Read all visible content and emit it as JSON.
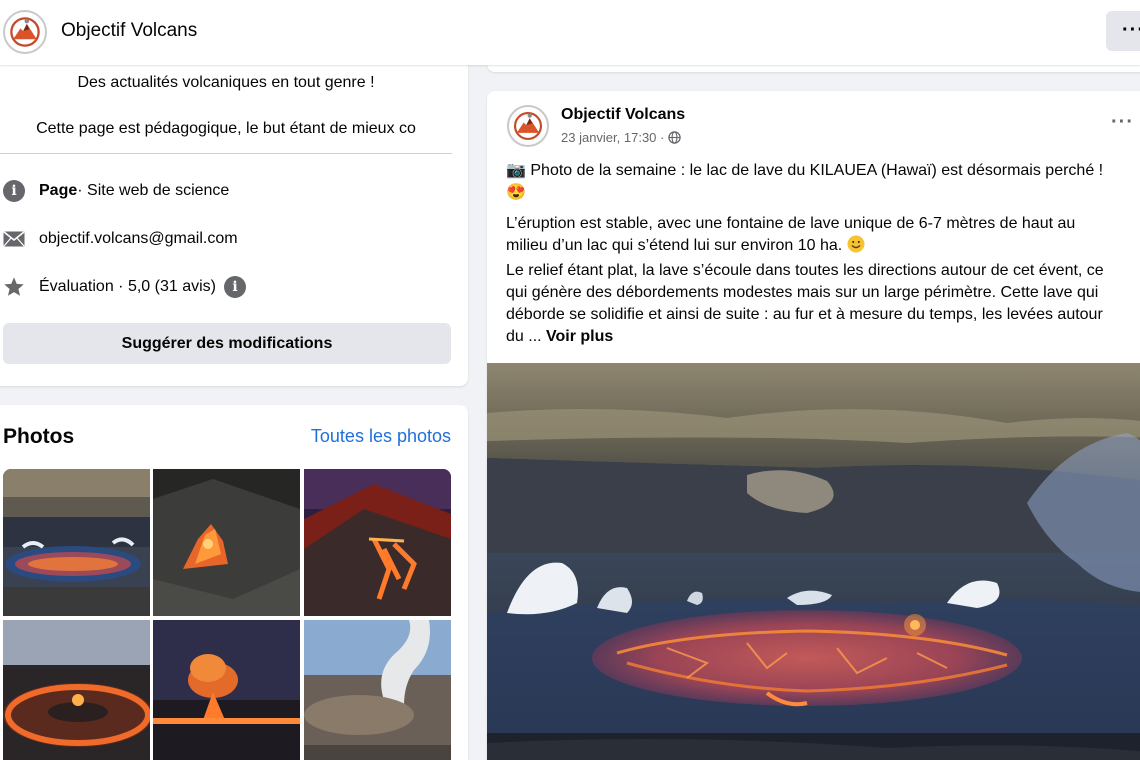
{
  "header": {
    "page_name": "Objectif Volcans",
    "more_label": "···"
  },
  "intro": {
    "line1": "Des actualités volcaniques en tout genre !",
    "line2": "Cette page est pédagogique, le but étant de mieux co",
    "page_type_bold": "Page",
    "page_type_rest": " · Site web de science",
    "email": "objectif.volcans@gmail.com",
    "rating": "Évaluation · 5,0 (31 avis)",
    "suggest_button": "Suggérer des modifications"
  },
  "photos": {
    "title": "Photos",
    "see_all": "Toutes les photos",
    "thumbnails": [
      "lava-lake-crater",
      "lava-fountain-closeup",
      "volcano-lava-flows-night",
      "crater-rim-lava-ring",
      "eruption-plume-dusk",
      "steam-plume-crater"
    ]
  },
  "post": {
    "author": "Objectif Volcans",
    "date": "23 janvier, 17:30 ·",
    "more_label": "···",
    "headline_emoji_start": "📷",
    "headline": "Photo de la semaine : le lac de lave du KILAUEA (Hawaï) est désormais perché !",
    "headline_emoji_end": "😍",
    "body_line1": "L’éruption est stable, avec une fontaine de lave unique de 6-7 mètres de haut au",
    "body_line2": "milieu d’un lac qui s’étend lui sur environ 10 ha. ",
    "body_line3": "Le relief étant plat, la lave s’écoule dans toutes les directions autour de cet évent, ce",
    "body_line4": "qui génère des débordements modestes mais sur un large périmètre. Cette lave qui",
    "body_line5": "déborde se solidifie et ainsi de suite : au fur et à mesure du temps, les levées autour",
    "body_line6": "du ... ",
    "see_more": "Voir plus"
  },
  "colors": {
    "link": "#216fdb",
    "button_bg": "#e4e6eb",
    "page_bg": "#f0f2f5",
    "secondary_text": "#65676b"
  }
}
